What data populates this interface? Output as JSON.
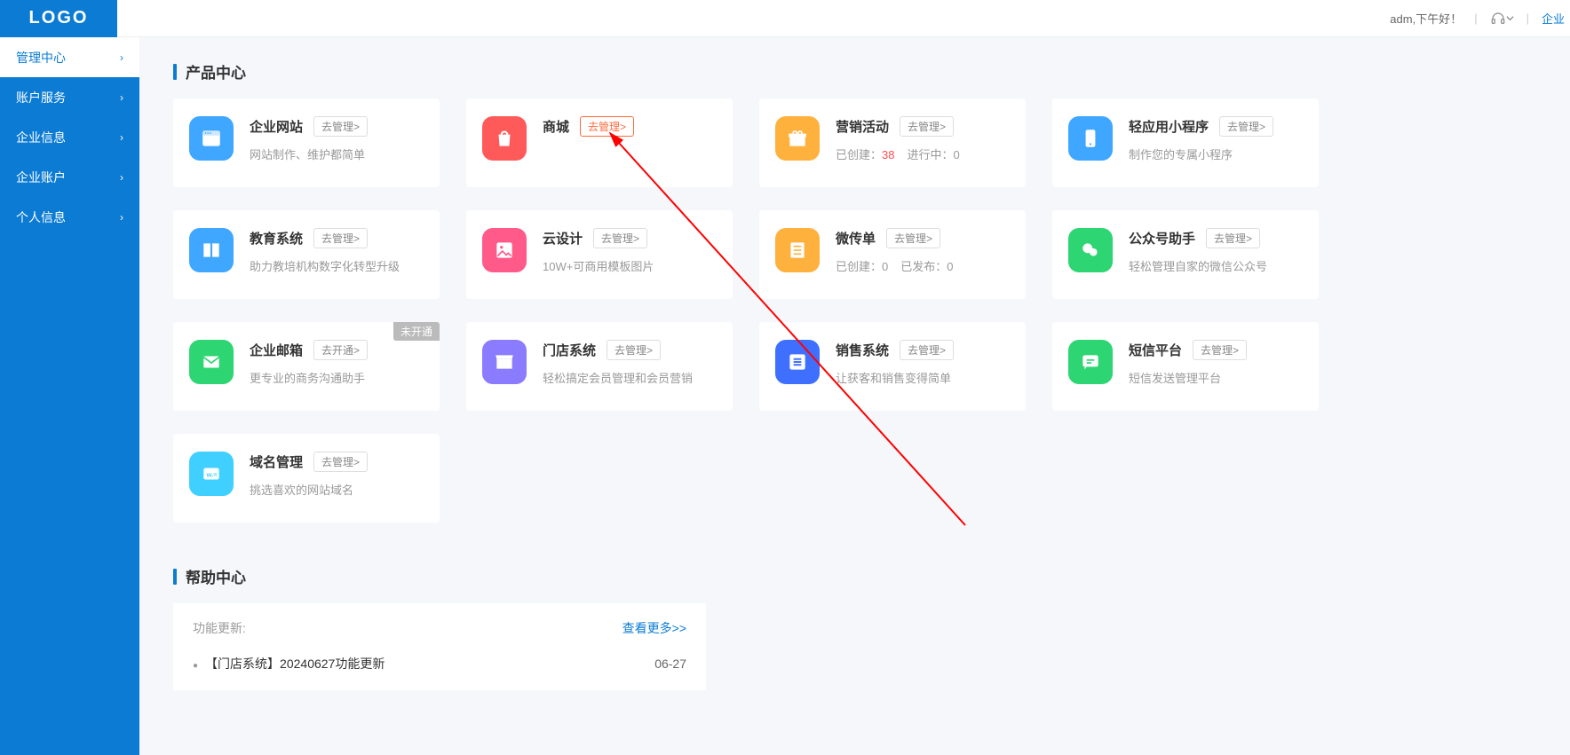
{
  "header": {
    "logo": "LOGO",
    "greeting": "adm,下午好！",
    "enterprise_link": "企业"
  },
  "sidebar": {
    "items": [
      {
        "label": "管理中心",
        "active": true
      },
      {
        "label": "账户服务",
        "active": false
      },
      {
        "label": "企业信息",
        "active": false
      },
      {
        "label": "企业账户",
        "active": false
      },
      {
        "label": "个人信息",
        "active": false
      }
    ]
  },
  "sections": {
    "product_center_title": "产品中心",
    "help_center_title": "帮助中心"
  },
  "actions": {
    "manage": "去管理>",
    "open": "去开通>"
  },
  "products": [
    {
      "icon": "window",
      "color": "#3fa7ff",
      "title": "企业网站",
      "action": "manage",
      "desc": "网站制作、维护都简单"
    },
    {
      "icon": "bag",
      "color": "#ff5a5a",
      "title": "商城",
      "action": "manage",
      "hot": true,
      "desc": ""
    },
    {
      "icon": "gift",
      "color": "#ffb13d",
      "title": "营销活动",
      "action": "manage",
      "stats": [
        {
          "label": "已创建：",
          "value": "38",
          "highlight": true
        },
        {
          "label": "进行中：",
          "value": "0"
        }
      ]
    },
    {
      "icon": "phone",
      "color": "#3fa7ff",
      "title": "轻应用小程序",
      "action": "manage",
      "desc": "制作您的专属小程序"
    },
    {
      "icon": "book",
      "color": "#3fa7ff",
      "title": "教育系统",
      "action": "manage",
      "desc": "助力教培机构数字化转型升级"
    },
    {
      "icon": "image",
      "color": "#ff5a8a",
      "title": "云设计",
      "action": "manage",
      "desc": "10W+可商用模板图片"
    },
    {
      "icon": "sheet",
      "color": "#ffb13d",
      "title": "微传单",
      "action": "manage",
      "stats": [
        {
          "label": "已创建：",
          "value": "0"
        },
        {
          "label": "已发布：",
          "value": "0"
        }
      ]
    },
    {
      "icon": "wechat",
      "color": "#2ed573",
      "title": "公众号助手",
      "action": "manage",
      "desc": "轻松管理自家的微信公众号"
    },
    {
      "icon": "mail",
      "color": "#2ed573",
      "title": "企业邮箱",
      "action": "open",
      "desc": "更专业的商务沟通助手",
      "badge": "未开通"
    },
    {
      "icon": "store",
      "color": "#8a7bff",
      "title": "门店系统",
      "action": "manage",
      "desc": "轻松搞定会员管理和会员营销"
    },
    {
      "icon": "list",
      "color": "#3f6fff",
      "title": "销售系统",
      "action": "manage",
      "desc": "让获客和销售变得简单"
    },
    {
      "icon": "chat",
      "color": "#2ed573",
      "title": "短信平台",
      "action": "manage",
      "desc": "短信发送管理平台"
    },
    {
      "icon": "domain",
      "color": "#3fd0ff",
      "title": "域名管理",
      "action": "manage",
      "desc": "挑选喜欢的网站域名"
    }
  ],
  "help": {
    "panel_title": "功能更新:",
    "more": "查看更多>>",
    "items": [
      {
        "title": "【门店系统】20240627功能更新",
        "date": "06-27"
      }
    ]
  },
  "icon_titles": {
    "headset": "客服"
  }
}
